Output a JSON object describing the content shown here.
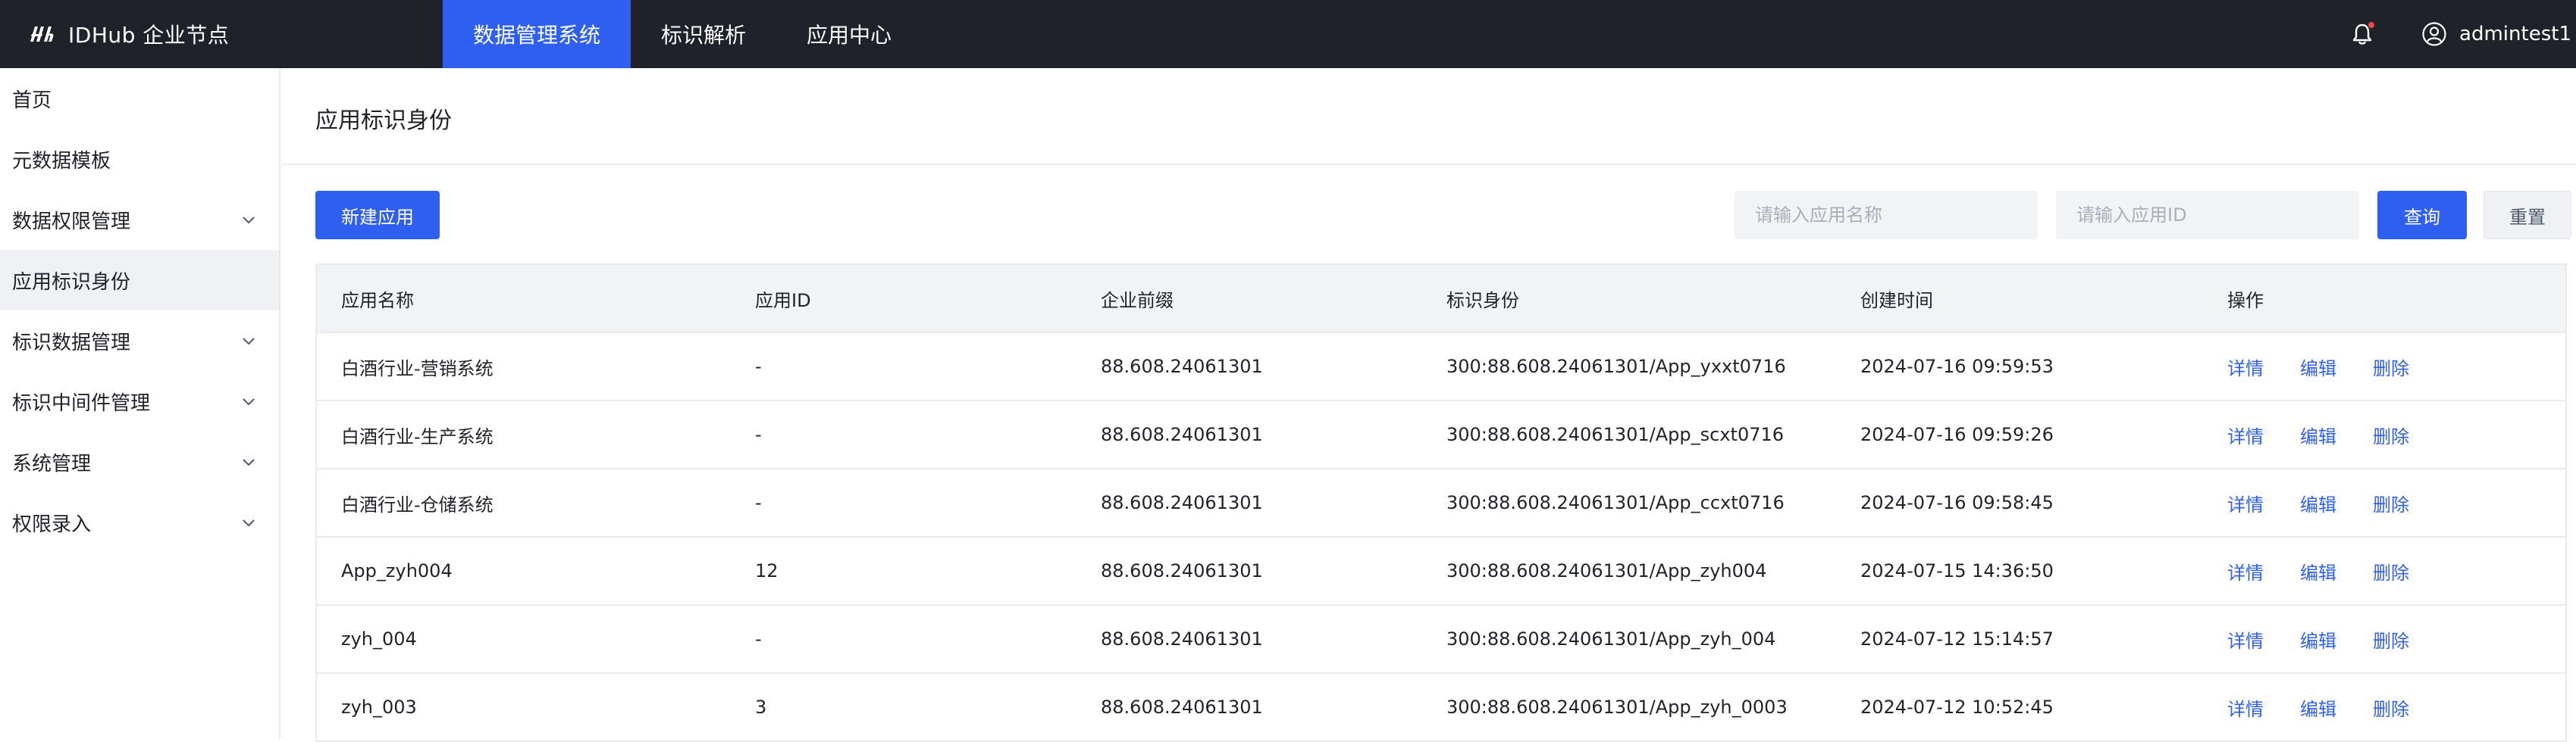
{
  "brand": {
    "name": "IDHub 企业节点"
  },
  "nav": {
    "items": [
      {
        "label": "数据管理系统",
        "active": true
      },
      {
        "label": "标识解析",
        "active": false
      },
      {
        "label": "应用中心",
        "active": false
      }
    ]
  },
  "header": {
    "username": "admintest1",
    "icons": [
      "bell-icon",
      "user-icon"
    ]
  },
  "sidebar": {
    "items": [
      {
        "label": "首页",
        "expandable": false,
        "active": false
      },
      {
        "label": "元数据模板",
        "expandable": false,
        "active": false
      },
      {
        "label": "数据权限管理",
        "expandable": true,
        "active": false
      },
      {
        "label": "应用标识身份",
        "expandable": false,
        "active": true
      },
      {
        "label": "标识数据管理",
        "expandable": true,
        "active": false
      },
      {
        "label": "标识中间件管理",
        "expandable": true,
        "active": false
      },
      {
        "label": "系统管理",
        "expandable": true,
        "active": false
      },
      {
        "label": "权限录入",
        "expandable": true,
        "active": false
      }
    ]
  },
  "page": {
    "title": "应用标识身份"
  },
  "toolbar": {
    "new_button": "新建应用",
    "name_placeholder": "请输入应用名称",
    "id_placeholder": "请输入应用ID",
    "query_button": "查询",
    "reset_button": "重置"
  },
  "table": {
    "headers": [
      "应用名称",
      "应用ID",
      "企业前缀",
      "标识身份",
      "创建时间",
      "操作"
    ],
    "actions": [
      "详情",
      "编辑",
      "删除"
    ],
    "rows": [
      [
        "白酒行业-营销系统",
        "-",
        "88.608.24061301",
        "300:88.608.24061301/App_yxxt0716",
        "2024-07-16 09:59:53"
      ],
      [
        "白酒行业-生产系统",
        "-",
        "88.608.24061301",
        "300:88.608.24061301/App_scxt0716",
        "2024-07-16 09:59:26"
      ],
      [
        "白酒行业-仓储系统",
        "-",
        "88.608.24061301",
        "300:88.608.24061301/App_ccxt0716",
        "2024-07-16 09:58:45"
      ],
      [
        "App_zyh004",
        "12",
        "88.608.24061301",
        "300:88.608.24061301/App_zyh004",
        "2024-07-15 14:36:50"
      ],
      [
        "zyh_004",
        "-",
        "88.608.24061301",
        "300:88.608.24061301/App_zyh_004",
        "2024-07-12 15:14:57"
      ],
      [
        "zyh_003",
        "3",
        "88.608.24061301",
        "300:88.608.24061301/App_zyh_0003",
        "2024-07-12 10:52:45"
      ]
    ]
  },
  "colors": {
    "topbar": "#1f2329",
    "accent": "#2f5ff0",
    "notification_dot": "#f04848"
  }
}
